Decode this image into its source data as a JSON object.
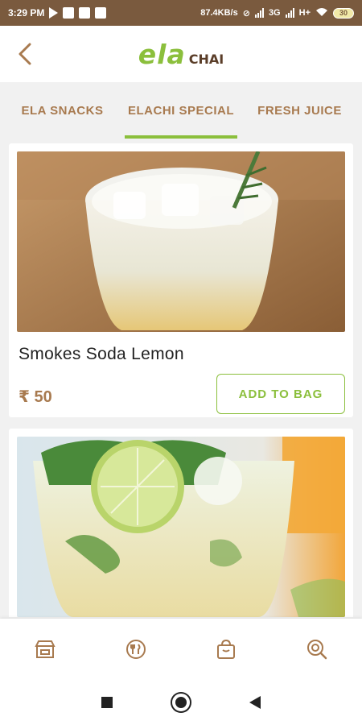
{
  "status_bar": {
    "time": "3:29 PM",
    "network_speed": "87.4KB/s",
    "network_type_1": "3G",
    "network_type_2": "H+",
    "battery": "30"
  },
  "header": {
    "logo_primary": "ela",
    "logo_secondary": "CHAI"
  },
  "tabs": [
    {
      "label": "ELA SNACKS",
      "active": false
    },
    {
      "label": "ELACHI SPECIAL",
      "active": true
    },
    {
      "label": "FRESH JUICE",
      "active": false
    }
  ],
  "products": [
    {
      "name": "Smokes Soda Lemon",
      "price": "₹ 50",
      "button": "ADD TO BAG"
    }
  ],
  "colors": {
    "accent_green": "#8bbf3c",
    "brand_brown": "#a87a4f",
    "status_bar": "#7a5a3e"
  },
  "bottom_nav": [
    {
      "icon": "store-icon"
    },
    {
      "icon": "menu-fork-knife-icon"
    },
    {
      "icon": "shopping-bag-icon"
    },
    {
      "icon": "search-icon"
    }
  ]
}
